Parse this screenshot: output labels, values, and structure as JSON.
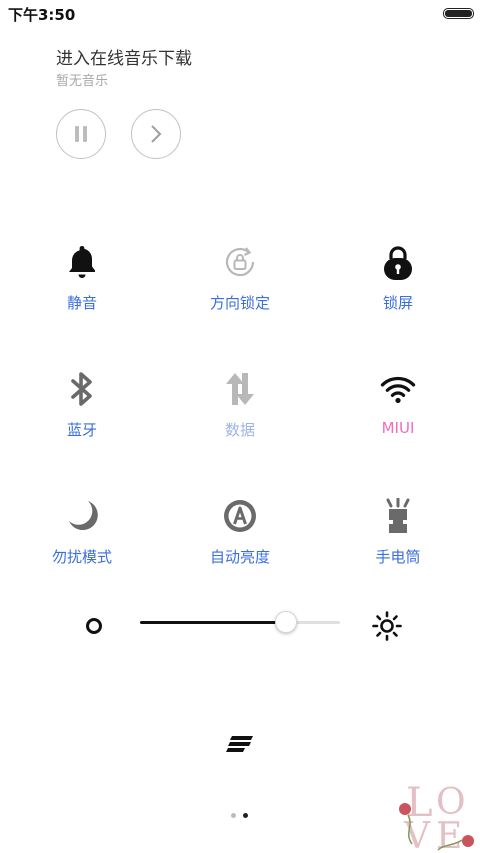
{
  "status_bar": {
    "time": "下午3:50",
    "battery_level": 1.0
  },
  "music": {
    "title": "进入在线音乐下载",
    "subtitle": "暂无音乐",
    "pause_icon": "pause-icon",
    "next_icon": "chevron-right-icon"
  },
  "toggles": [
    {
      "label": "静音",
      "icon": "bell-icon",
      "state": "active"
    },
    {
      "label": "方向锁定",
      "icon": "rotation-lock-icon",
      "state": "inactive"
    },
    {
      "label": "锁屏",
      "icon": "padlock-icon",
      "state": "active"
    },
    {
      "label": "蓝牙",
      "icon": "bluetooth-icon",
      "state": "inactive"
    },
    {
      "label": "数据",
      "icon": "data-sync-icon",
      "state": "inactive"
    },
    {
      "label": "MIUI",
      "icon": "wifi-icon",
      "state": "active"
    },
    {
      "label": "勿扰模式",
      "icon": "moon-icon",
      "state": "inactive"
    },
    {
      "label": "自动亮度",
      "icon": "auto-brightness-icon",
      "state": "inactive"
    },
    {
      "label": "手电筒",
      "icon": "flashlight-icon",
      "state": "inactive"
    }
  ],
  "brightness": {
    "level_percent": 73
  },
  "pager": {
    "pages": 2,
    "current": 2
  },
  "colors": {
    "label_blue": "#3b6ee0",
    "label_pink": "#f06cc1",
    "label_dim": "#9fb3e8"
  },
  "decoration": {
    "text": "LOVE"
  }
}
